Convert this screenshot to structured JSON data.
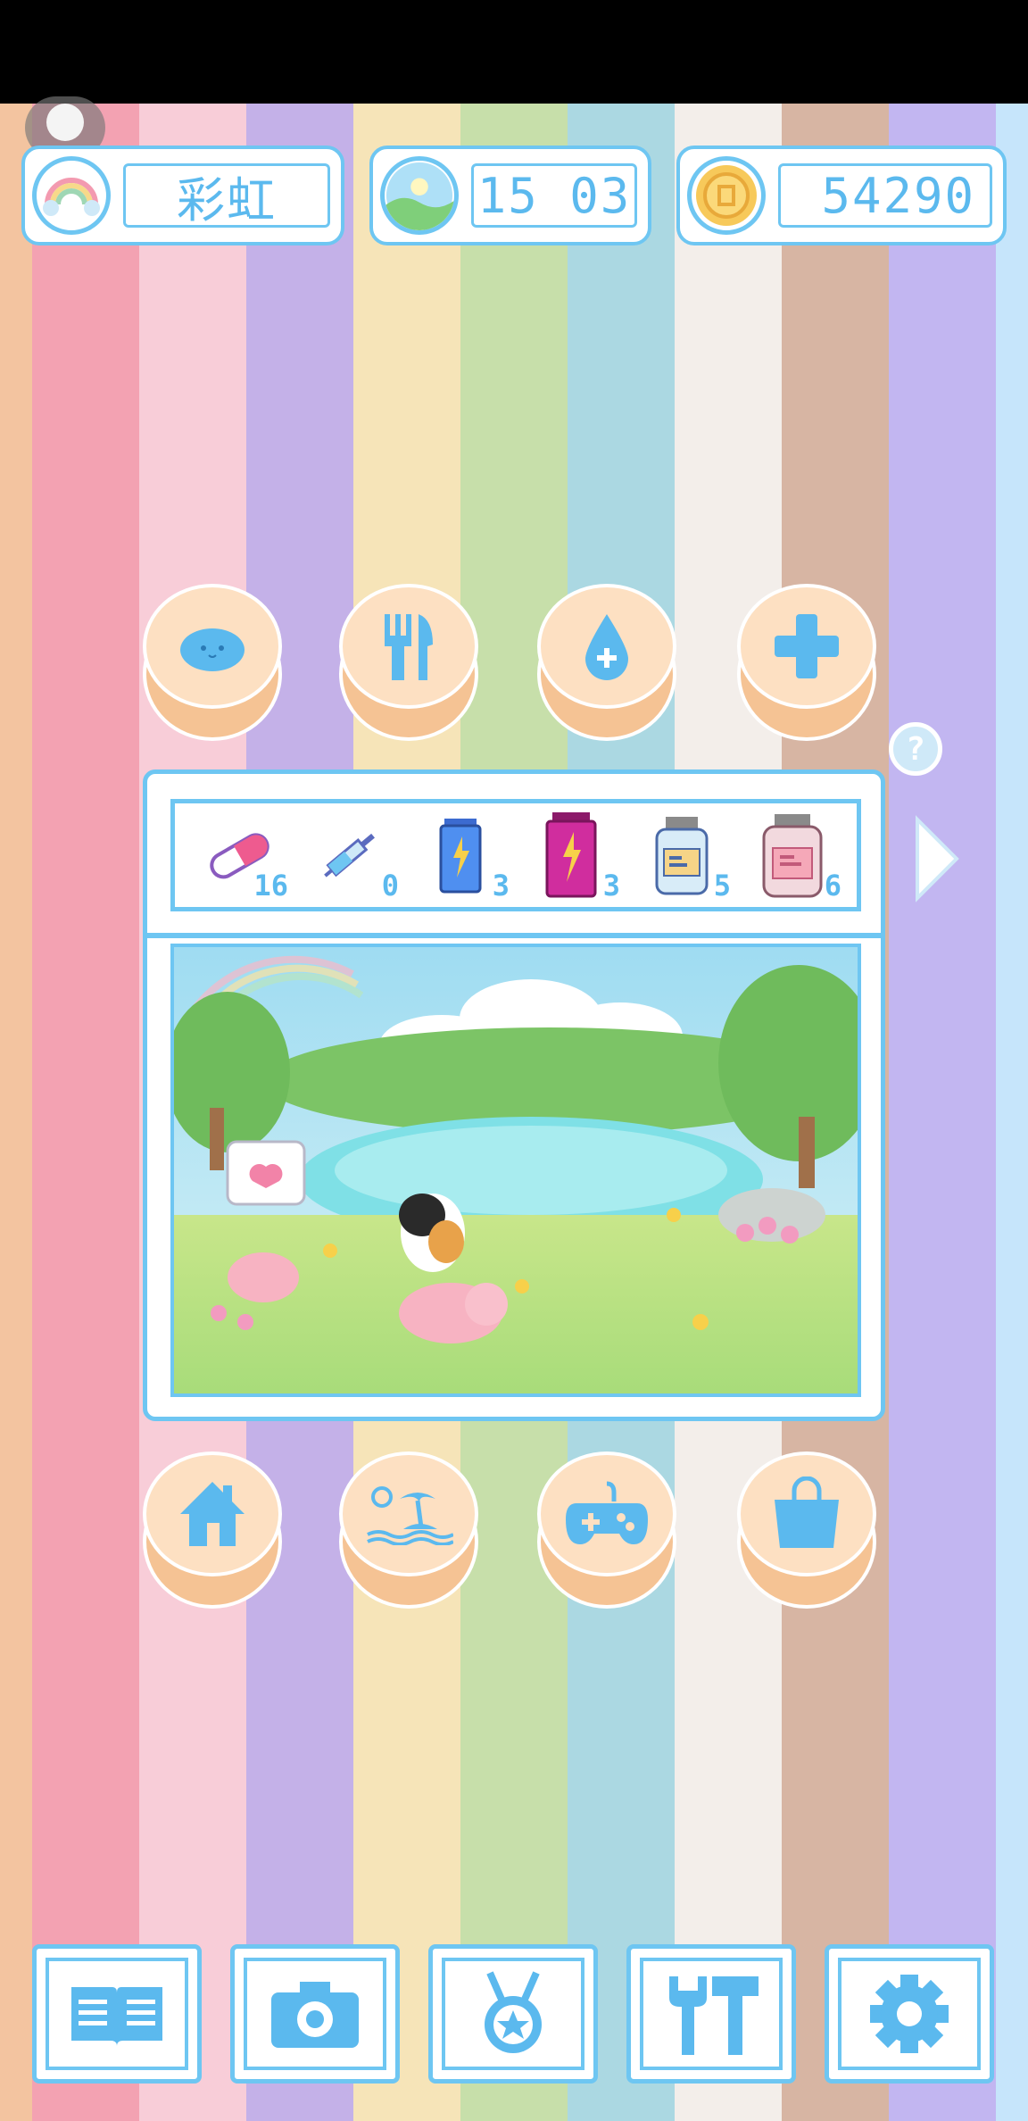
{
  "stripe_colors": [
    "#f3c4a0",
    "#f3a2b2",
    "#f8cdd8",
    "#c4b1e8",
    "#f6e4b8",
    "#c7dfaa",
    "#abd8e2",
    "#f3eeea",
    "#d7b5a3",
    "#c2b6f1",
    "#c6e5fb"
  ],
  "header": {
    "pet_name": "彩虹",
    "day_time": "15 03",
    "coins": "54290"
  },
  "action_buttons_top": [
    {
      "icon": "slime-icon",
      "label": ""
    },
    {
      "icon": "fork-knife-icon",
      "label": ""
    },
    {
      "icon": "water-drop-icon",
      "label": ""
    },
    {
      "icon": "plus-icon",
      "label": ""
    }
  ],
  "help": {
    "symbol": "?"
  },
  "items": [
    {
      "name": "pill",
      "icon": "pill-icon",
      "count": "16"
    },
    {
      "name": "syringe",
      "icon": "syringe-icon",
      "count": "0"
    },
    {
      "name": "blue-energy-drink",
      "icon": "blue-energy-drink-icon",
      "count": "3"
    },
    {
      "name": "pink-energy-drink",
      "icon": "pink-energy-drink-icon",
      "count": "3"
    },
    {
      "name": "blue-jar",
      "icon": "blue-jar-icon",
      "count": "5"
    },
    {
      "name": "pink-jar",
      "icon": "pink-jar-icon",
      "count": "6"
    }
  ],
  "action_buttons_bottom": [
    {
      "icon": "house-icon"
    },
    {
      "icon": "beach-island-icon"
    },
    {
      "icon": "gamepad-icon"
    },
    {
      "icon": "shopping-bag-icon"
    }
  ],
  "bottom_nav": [
    {
      "icon": "book-icon"
    },
    {
      "icon": "camera-icon"
    },
    {
      "icon": "medal-icon"
    },
    {
      "icon": "tools-icon"
    },
    {
      "icon": "settings-gear-icon"
    }
  ],
  "colors": {
    "accent": "#6ec6f2",
    "button_face": "#fde0c2",
    "button_base": "#f5c394"
  }
}
